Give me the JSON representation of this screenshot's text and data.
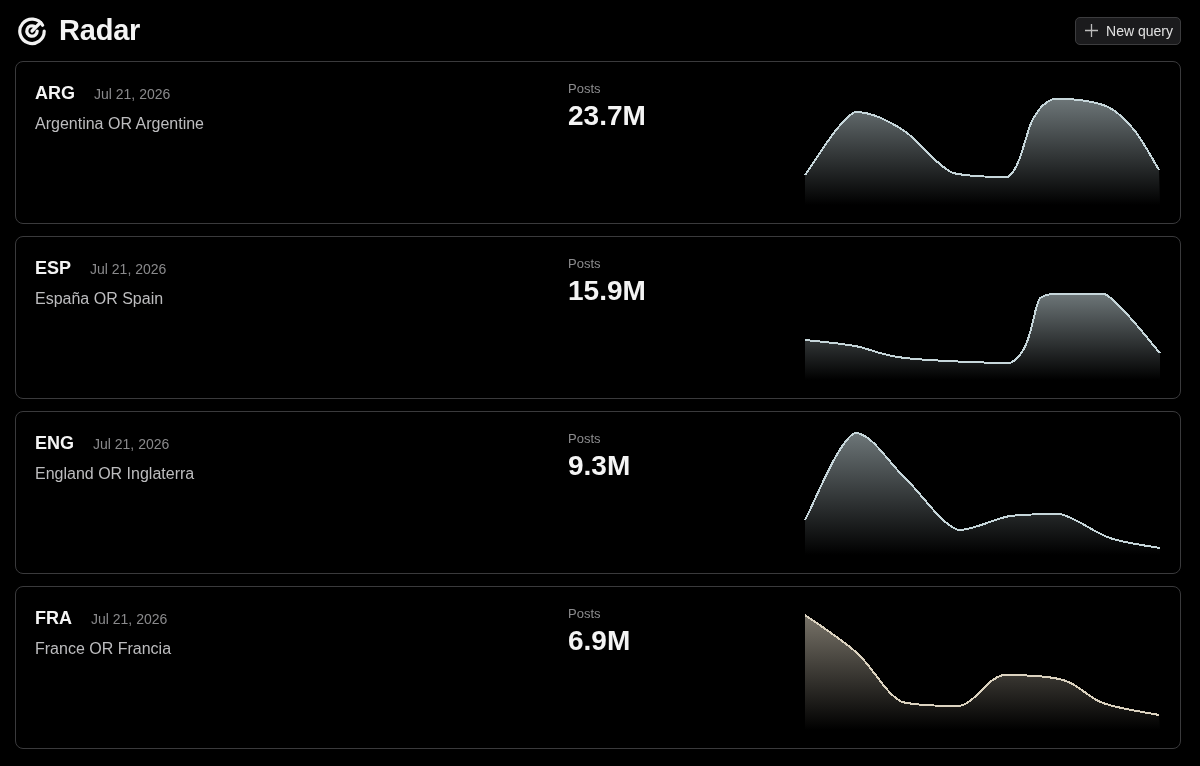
{
  "header": {
    "title": "Radar",
    "new_query_button": {
      "label": "New query"
    }
  },
  "queries": [
    {
      "code": "ARG",
      "date": "Jul 21, 2026",
      "query": "Argentina OR Argentine",
      "posts_label": "Posts",
      "posts": "23.7M",
      "color": "#c6d6da"
    },
    {
      "code": "ESP",
      "date": "Jul 21, 2026",
      "query": "España OR Spain",
      "posts_label": "Posts",
      "posts": "15.9M",
      "color": "#c6d6da"
    },
    {
      "code": "ENG",
      "date": "Jul 21, 2026",
      "query": "England OR Inglaterra",
      "posts_label": "Posts",
      "posts": "9.3M",
      "color": "#c6d6da"
    },
    {
      "code": "FRA",
      "date": "Jul 21, 2026",
      "query": "France OR Francia",
      "posts_label": "Posts",
      "posts": "6.9M",
      "color": "#dbd2bf"
    }
  ]
}
